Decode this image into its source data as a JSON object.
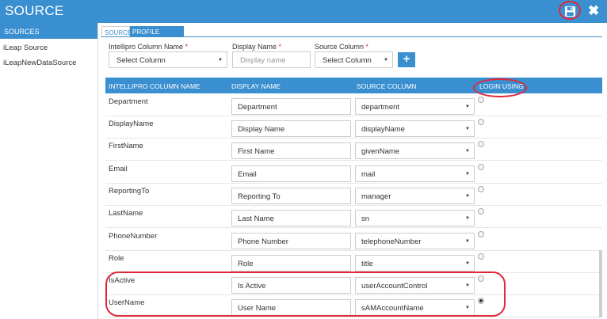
{
  "window": {
    "title": "SOURCE"
  },
  "sidebar": {
    "header": "SOURCES",
    "items": [
      {
        "label": "iLeap Source"
      },
      {
        "label": "iLeapNewDataSource"
      }
    ]
  },
  "tabs": [
    {
      "label": "SOURCE"
    },
    {
      "label": "PROFILE MAPPING"
    }
  ],
  "form": {
    "column_name_label": "Intellipro Column Name",
    "column_name_value": "Select Column",
    "display_name_label": "Display Name",
    "display_name_placeholder": "Display name",
    "source_column_label": "Source Column",
    "source_column_value": "Select Column",
    "required_mark": "*",
    "add_label": "+"
  },
  "table": {
    "headers": [
      "INTELLIPRO COLUMN NAME",
      "DISPLAY NAME",
      "SOURCE COLUMN",
      "LOGIN USING"
    ],
    "rows": [
      {
        "name": "Department",
        "display": "Department",
        "source": "department",
        "login": false
      },
      {
        "name": "DisplayName",
        "display": "Display Name",
        "source": "displayName",
        "login": false
      },
      {
        "name": "FirstName",
        "display": "First Name",
        "source": "givenName",
        "login": false
      },
      {
        "name": "Email",
        "display": "Email",
        "source": "mail",
        "login": false
      },
      {
        "name": "ReportingTo",
        "display": "Reporting To",
        "source": "manager",
        "login": false
      },
      {
        "name": "LastName",
        "display": "Last Name",
        "source": "sn",
        "login": false
      },
      {
        "name": "PhoneNumber",
        "display": "Phone Number",
        "source": "telephoneNumber",
        "login": false
      },
      {
        "name": "Role",
        "display": "Role",
        "source": "title",
        "login": false
      },
      {
        "name": "IsActive",
        "display": "Is Active",
        "source": "userAccountControl",
        "login": false
      },
      {
        "name": "UserName",
        "display": "User Name",
        "source": "sAMAccountName",
        "login": true
      }
    ]
  },
  "icons": {
    "save": "save-icon",
    "close": "close-icon",
    "dropdown": "caret-down-icon"
  },
  "colors": {
    "accent": "#3a8fd0",
    "annotation": "#e0283a"
  }
}
